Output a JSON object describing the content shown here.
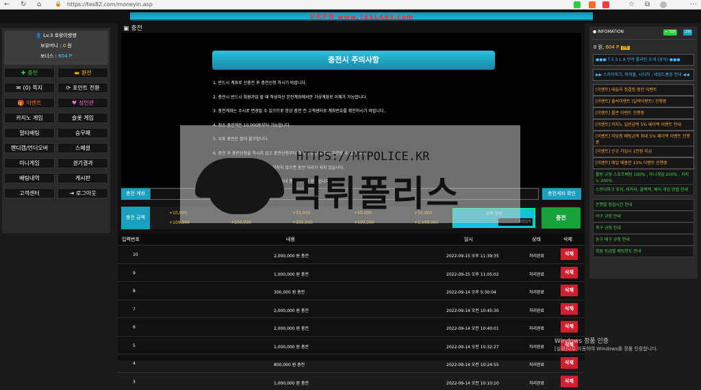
{
  "browser": {
    "url": "https://tes82.com/moneyin.asp"
  },
  "site": {
    "brand_banner": "우리은행 www.TESLA85.com"
  },
  "user": {
    "level_name": "Lv.3 호랑이썅썅",
    "balance_label": "보유머니 :",
    "balance_value": "0",
    "balance_unit": "원",
    "bonus_label": "보너스 :",
    "bonus_value": "604 P"
  },
  "left_menu": [
    {
      "label": "충전",
      "icon": "plus-icon",
      "color": "#2ecc40"
    },
    {
      "label": "환전",
      "icon": "minus-icon",
      "color": "#ffb400"
    },
    {
      "label": "(0) 쪽지",
      "icon": "mail-icon",
      "color": "#ffffff"
    },
    {
      "label": "포인트 전환",
      "icon": "refresh-icon",
      "color": "#ffffff"
    },
    {
      "label": "이벤트",
      "icon": "gift-icon",
      "color": "#ff6b2b"
    },
    {
      "label": "성인관",
      "icon": "heart-icon",
      "color": "#ff6bd3"
    },
    {
      "label": "카지노 게임",
      "icon": "",
      "color": "#ffffff"
    },
    {
      "label": "슬롯 게임",
      "icon": "",
      "color": "#ffffff"
    },
    {
      "label": "멀티배팅",
      "icon": "",
      "color": "#ffffff"
    },
    {
      "label": "승무패",
      "icon": "",
      "color": "#ffffff"
    },
    {
      "label": "핸디캡/언더오버",
      "icon": "",
      "color": "#ffffff"
    },
    {
      "label": "스페셜",
      "icon": "",
      "color": "#ffffff"
    },
    {
      "label": "미니게임",
      "icon": "",
      "color": "#ffffff"
    },
    {
      "label": "경기결과",
      "icon": "",
      "color": "#ffffff"
    },
    {
      "label": "배팅내역",
      "icon": "",
      "color": "#ffffff"
    },
    {
      "label": "게시판",
      "icon": "",
      "color": "#ffffff"
    },
    {
      "label": "고객센터",
      "icon": "",
      "color": "#ffffff"
    },
    {
      "label": "로그아웃",
      "icon": "logout-icon",
      "color": "#ffffff"
    }
  ],
  "main": {
    "page_title": "충전",
    "notice_title": "충전시 주의사항",
    "notice_items": [
      "1. 반드시 계좌로 선충전 후 충전신청 하시기 바랍니다.",
      "2. 충전시 반드시 회원가입 할 때 작성하신 본인계좌에서만 가상계좌로 이체가 가능합니다.",
      "3. 충전계좌는 수시로 변경될 수 있으므로 항상 충전 전 고객센터로 계좌번호를 확인하시기 바랍니다.",
      "4. 최소 충전액은 10,000원부터 가능합니다.",
      "5. 수표 충전은 절대 불가합니다.",
      "6. 충전 후 충전신청을 하시지 않고 충전신청부터 하시면 충전 처리가 지연될 수 있습니다.",
      "7. 충전 계좌 성명과 충전자명이 일치하지 않으면 충전 처리가 되지 않습니다.",
      "8. 상기의 사항을 잘 지켜주신다면 3분 이내 충전 처리가 완료됩니다."
    ],
    "account_label": "충전 계좌",
    "account_check_button": "충전계좌 확인",
    "amount_label": "충전 금액",
    "amount_buttons_row1": [
      "+10,000",
      "+20,000",
      "+33,000",
      "+50,000",
      "+50,000"
    ],
    "amount_buttons_row2": [
      "+100,000",
      "+200,000",
      "+300,000",
      "+500,000",
      "+1,000,000"
    ],
    "amount_reset": "금액 정정",
    "amount_direct": "직접입력",
    "charge_button": "충전",
    "table_headers": [
      "입력번호",
      "내용",
      "일시",
      "상태",
      "삭제"
    ],
    "rows": [
      {
        "no": "10",
        "content": "2,000,000 원 충전",
        "date": "2022-09-15 오후 11:39:35",
        "status": "처리완료",
        "del": "삭제"
      },
      {
        "no": "9",
        "content": "1,000,000 원 충전",
        "date": "2022-09-15 오후 11:05:02",
        "status": "처리완료",
        "del": "삭제"
      },
      {
        "no": "8",
        "content": "300,000 원 충전",
        "date": "2022-09-14 오후 5:30:04",
        "status": "처리완료",
        "del": "삭제"
      },
      {
        "no": "7",
        "content": "2,000,000 원 충전",
        "date": "2022-09-14 오전 10:45:30",
        "status": "처리완료",
        "del": "삭제"
      },
      {
        "no": "6",
        "content": "2,000,000 원 충전",
        "date": "2022-09-14 오전 10:40:01",
        "status": "처리완료",
        "del": "삭제"
      },
      {
        "no": "5",
        "content": "1,000,000 원 충전",
        "date": "2022-09-14 오전 10:32:27",
        "status": "처리완료",
        "del": "삭제"
      },
      {
        "no": "4",
        "content": "800,000 원 충전",
        "date": "2022-09-14 오전 10:24:55",
        "status": "처리완료",
        "del": "삭제"
      },
      {
        "no": "3",
        "content": "1,000,000 원 충전",
        "date": "2022-09-14 오전 10:10:10",
        "status": "처리완료",
        "del": "삭제"
      }
    ]
  },
  "right": {
    "header": "INFOMATION",
    "tag_top": "+ TOP",
    "tag_bottom": "고정",
    "balance": "0 원,",
    "points": "604 P",
    "points_btn": "전환",
    "notices": [
      {
        "text": "●●● T E S L A 만의 룰라틴 소개 (공식) ●●●",
        "type": "blue"
      },
      {
        "text": "▶▶ 스카이파크, 파워볼, 시디러 , 네임드홈덤 안내 ◀◀",
        "type": "blue"
      },
      {
        "text": "[이벤트] 테슬라 첫결험 충전 이벤트",
        "type": "orange"
      },
      {
        "text": "[이벤트] 출석이벤트 (달력이벤트) 진행중",
        "type": "orange"
      },
      {
        "text": "[이벤트] 룰콘 이벤트 진행중",
        "type": "orange"
      },
      {
        "text": "[이벤트] 카지노 일반금액 5% 페이백 이벤트 안내",
        "type": "orange"
      },
      {
        "text": "[이벤트] 미당첨 배팅금액 최대 5% 페이백 이벤트 진행중",
        "type": "orange"
      },
      {
        "text": "[이벤트] 신규 가입시 1만원 지급",
        "type": "orange"
      },
      {
        "text": "[이벤트] 매일 매충전 10% 이벤트 진행중",
        "type": "orange"
      },
      {
        "text": "롤링 규정 스포츠배팅 100% , 미니게임 200% , 카지노 200%",
        "type": "green"
      },
      {
        "text": "스카이파크 포커, 바카라, 블랙잭, 페어 게임 방법 안내",
        "type": "green"
      },
      {
        "text": "은행별 점검시간 안내",
        "type": "green"
      },
      {
        "text": "야구 규정 안내",
        "type": "green"
      },
      {
        "text": "축구 규정 안내",
        "type": "green"
      },
      {
        "text": "농구 배구 규정 안내",
        "type": "green"
      },
      {
        "text": "회원 등급별 배팅한도 안내",
        "type": "green"
      }
    ]
  },
  "watermark": {
    "url": "HTTPS://MTPOLICE.KR",
    "name": "먹튀폴리스"
  },
  "windows": {
    "line1": "Windows 정품 인증",
    "line2": "[설정]으로 이동하여 Windows를 정품 인증합니다."
  }
}
